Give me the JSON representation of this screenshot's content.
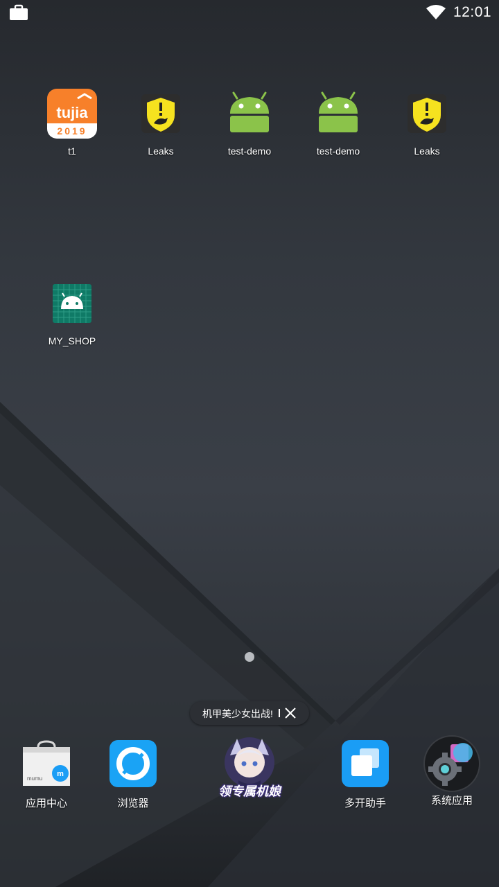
{
  "status_bar": {
    "time": "12:01",
    "icons": [
      "briefcase-icon",
      "wifi-icon"
    ]
  },
  "home_apps": [
    {
      "label": "t1",
      "icon": "tujia-icon",
      "icon_text": "tujia",
      "icon_year": "2019"
    },
    {
      "label": "Leaks",
      "icon": "leakcanary-icon"
    },
    {
      "label": "test-demo",
      "icon": "android-icon"
    },
    {
      "label": "test-demo",
      "icon": "android-icon"
    },
    {
      "label": "Leaks",
      "icon": "leakcanary-icon"
    },
    {
      "label": "MY_SHOP",
      "icon": "android-grid-icon"
    }
  ],
  "promo": {
    "text": "机甲美少女出战!"
  },
  "dock": [
    {
      "label": "应用中心",
      "icon": "shopping-bag-icon",
      "brand": "mumu"
    },
    {
      "label": "浏览器",
      "icon": "browser-icon"
    },
    {
      "label": "",
      "icon": "game-icon",
      "overlay": "领专属机娘"
    },
    {
      "label": "多开助手",
      "icon": "multi-window-icon"
    },
    {
      "label": "系统应用",
      "icon": "settings-gear-icon"
    }
  ],
  "colors": {
    "tujia_orange": "#f7802a",
    "leaks_yellow": "#f6e21f",
    "android_green": "#8bc34a",
    "browser_blue": "#1aa3f5",
    "multi_blue": "#1a9df5"
  }
}
